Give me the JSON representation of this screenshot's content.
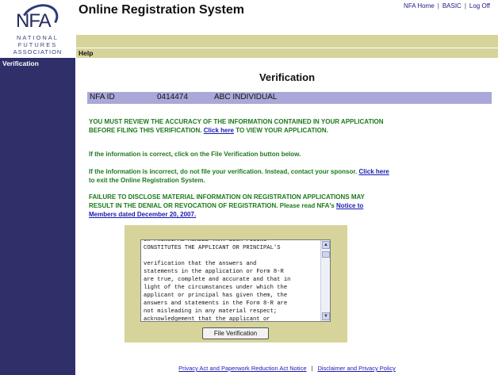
{
  "logo": {
    "text": "NFA",
    "line1": "NATIONAL",
    "line2": "FUTURES",
    "line3": "ASSOCIATION"
  },
  "header": {
    "title": "Online Registration System",
    "links": [
      "NFA Home",
      "BASIC",
      "Log Off"
    ],
    "separator": "|"
  },
  "menu": {
    "help": "Help"
  },
  "sidebar": {
    "items": [
      {
        "label": "Verification"
      }
    ]
  },
  "main": {
    "heading": "Verification",
    "id_label": "NFA ID",
    "id_value": "0414474",
    "entity_name": "ABC INDIVIDUAL",
    "msg1_pre": "YOU MUST REVIEW THE ACCURACY OF THE INFORMATION CONTAINED IN YOUR APPLICATION BEFORE FILING THIS VERIFICATION.",
    "msg1_link": "Click here",
    "msg1_post": "TO VIEW YOUR APPLICATION.",
    "msg2": "If the information is correct, click on the File Verification button below.",
    "msg3_pre": "If the information is incorrect, do not file your verification. Instead, contact your sponsor.",
    "msg3_link": "Click here",
    "msg3_post": "to exit the Online Registration System.",
    "msg4_pre": "FAILURE TO DISCLOSE MATERIAL INFORMATION ON REGISTRATION APPLICATIONS MAY RESULT IN THE DENIAL OR REVOCATION OF REGISTRATION. Please read NFA's",
    "msg4_link": "Notice to Members dated December 20, 2007.",
    "textarea_text": "OR PRINCIPAL AGREES THAT SUCH FILING\nCONSTITUTES THE APPLICANT OR PRINCIPAL'S\n\nverification that the answers and\nstatements in the application or Form 8-R\nare true, complete and accurate and that in\nlight of the circumstances under which the\napplicant or principal has given them, the\nanswers and statements in the Form 8-R are\nnot misleading in any material respect;\nacknowledgement that the applicant or",
    "file_button": "File Verification"
  },
  "footer": {
    "link1": "Privacy Act and Paperwork Reduction Act Notice",
    "separator": "|",
    "link2": "Disclaimer and Privacy Policy"
  },
  "colors": {
    "sidebar": "#2f2f6a",
    "olive": "#d6d49a",
    "id_bar": "#a9a8d8",
    "message_green": "#1c7a1c",
    "link_blue": "#1a1ab0"
  }
}
